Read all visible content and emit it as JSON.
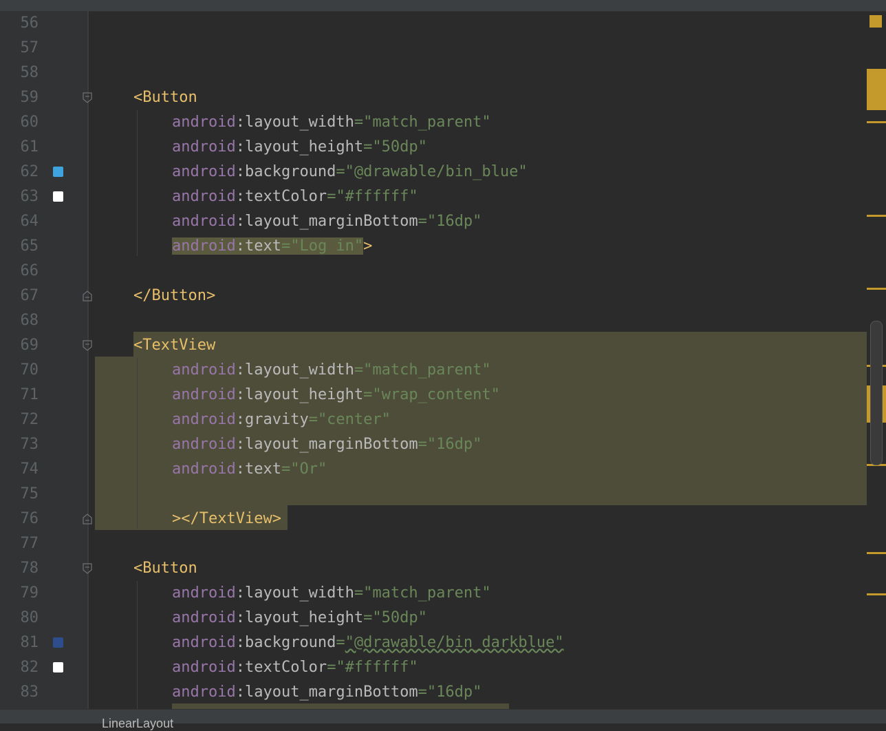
{
  "status_text": "LinearLayout",
  "colors": {
    "background": "#2b2b2b",
    "gutter": "#313335",
    "tag": "#e8bf6a",
    "namespace": "#9876aa",
    "value": "#6a8759",
    "highlight": "#4e4d3a",
    "marker": "#c59a2d"
  },
  "lines": [
    {
      "n": "56"
    },
    {
      "n": "57"
    },
    {
      "n": "58"
    },
    {
      "n": "59",
      "tag": "<Button"
    },
    {
      "n": "60",
      "ns": "android",
      "attr": "layout_width",
      "val": "\"match_parent\""
    },
    {
      "n": "61",
      "ns": "android",
      "attr": "layout_height",
      "val": "\"50dp\""
    },
    {
      "n": "62",
      "ns": "android",
      "attr": "background",
      "val": "\"@drawable/bin_blue\"",
      "swatch": "#3fa3e0"
    },
    {
      "n": "63",
      "ns": "android",
      "attr": "textColor",
      "val": "\"#ffffff\"",
      "swatch": "#ffffff"
    },
    {
      "n": "64",
      "ns": "android",
      "attr": "layout_marginBottom",
      "val": "\"16dp\""
    },
    {
      "n": "65",
      "ns": "android",
      "attr": "text",
      "val": "\"Log in\"",
      "close": ">"
    },
    {
      "n": "66"
    },
    {
      "n": "67",
      "tag": "</Button>"
    },
    {
      "n": "68"
    },
    {
      "n": "69",
      "tag": "<TextView"
    },
    {
      "n": "70",
      "ns": "android",
      "attr": "layout_width",
      "val": "\"match_parent\""
    },
    {
      "n": "71",
      "ns": "android",
      "attr": "layout_height",
      "val": "\"wrap_content\""
    },
    {
      "n": "72",
      "ns": "android",
      "attr": "gravity",
      "val": "\"center\""
    },
    {
      "n": "73",
      "ns": "android",
      "attr": "layout_marginBottom",
      "val": "\"16dp\""
    },
    {
      "n": "74",
      "ns": "android",
      "attr": "text",
      "val": "\"Or\""
    },
    {
      "n": "75"
    },
    {
      "n": "76",
      "tag": "></TextView>"
    },
    {
      "n": "77"
    },
    {
      "n": "78",
      "tag": "<Button"
    },
    {
      "n": "79",
      "ns": "android",
      "attr": "layout_width",
      "val": "\"match_parent\""
    },
    {
      "n": "80",
      "ns": "android",
      "attr": "layout_height",
      "val": "\"50dp\""
    },
    {
      "n": "81",
      "ns": "android",
      "attr": "background",
      "val": "\"@drawable/bin_darkblue\"",
      "swatch": "#2e4d8c"
    },
    {
      "n": "82",
      "ns": "android",
      "attr": "textColor",
      "val": "\"#ffffff\"",
      "swatch": "#ffffff"
    },
    {
      "n": "83",
      "ns": "android",
      "attr": "layout_marginBottom",
      "val": "\"16dp\""
    }
  ]
}
